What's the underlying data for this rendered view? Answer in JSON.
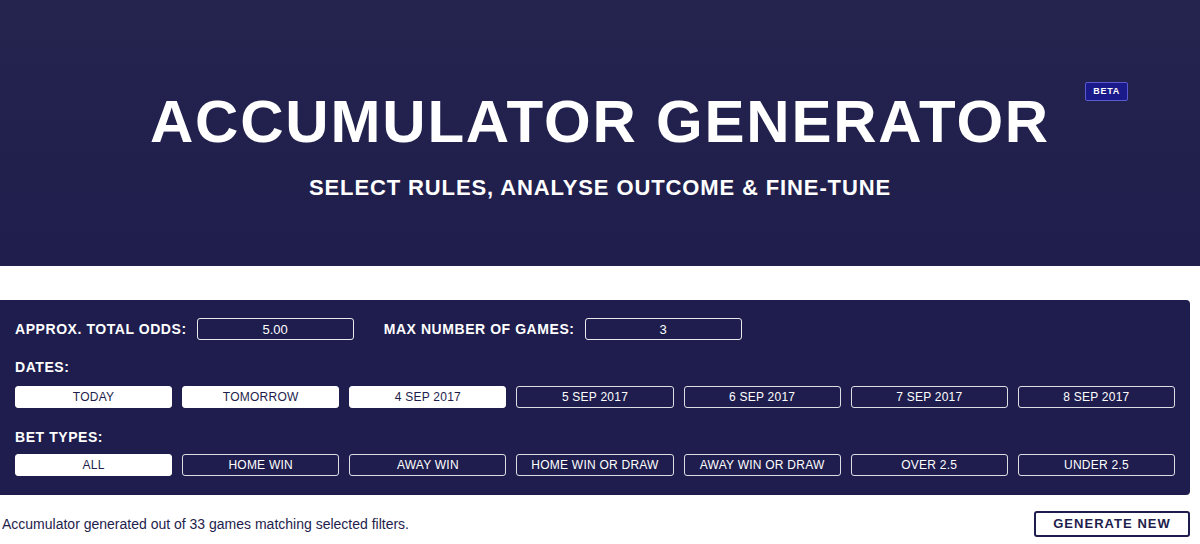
{
  "hero": {
    "title": "ACCUMULATOR GENERATOR",
    "badge": "BETA",
    "subtitle": "SELECT RULES, ANALYSE OUTCOME & FINE-TUNE"
  },
  "fields": [
    {
      "label": "APPROX. TOTAL ODDS:",
      "value": "5.00"
    },
    {
      "label": "MAX NUMBER OF GAMES:",
      "value": "3"
    }
  ],
  "dates": {
    "label": "DATES:",
    "options": [
      {
        "label": "TODAY",
        "selected": true
      },
      {
        "label": "TOMORROW",
        "selected": true
      },
      {
        "label": "4 SEP 2017",
        "selected": true
      },
      {
        "label": "5 SEP 2017",
        "selected": false
      },
      {
        "label": "6 SEP 2017",
        "selected": false
      },
      {
        "label": "7 SEP 2017",
        "selected": false
      },
      {
        "label": "8 SEP 2017",
        "selected": false
      }
    ]
  },
  "bet_types": {
    "label": "BET TYPES:",
    "options": [
      {
        "label": "ALL",
        "selected": true
      },
      {
        "label": "HOME WIN",
        "selected": false
      },
      {
        "label": "AWAY WIN",
        "selected": false
      },
      {
        "label": "HOME WIN OR DRAW",
        "selected": false
      },
      {
        "label": "AWAY WIN OR DRAW",
        "selected": false
      },
      {
        "label": "OVER 2.5",
        "selected": false
      },
      {
        "label": "UNDER 2.5",
        "selected": false
      }
    ]
  },
  "status": "Accumulator generated out of 33 games matching selected filters.",
  "buttons": [
    "GENERATE NEW"
  ]
}
